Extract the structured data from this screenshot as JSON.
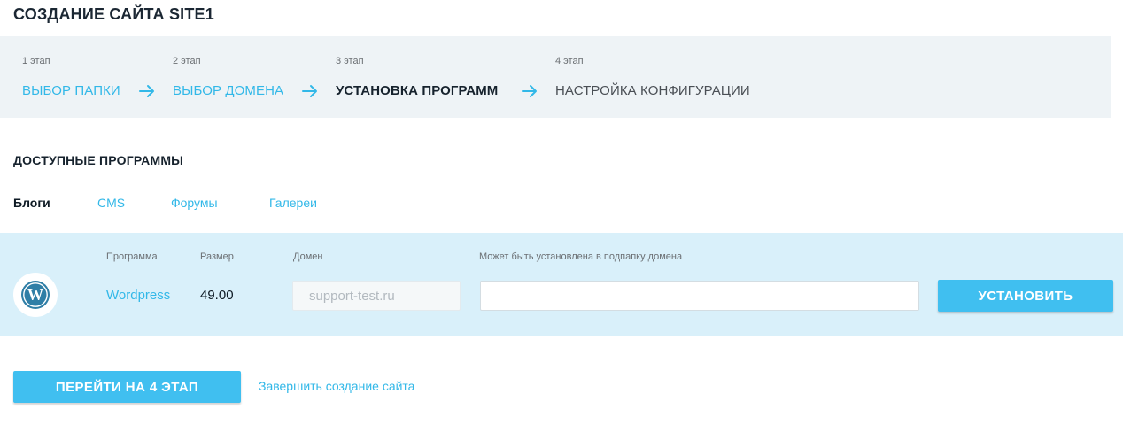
{
  "page": {
    "title": "СОЗДАНИЕ САЙТА SITE1"
  },
  "steps": [
    {
      "number": "1 этап",
      "label": "ВЫБОР ПАПКИ",
      "state": "done"
    },
    {
      "number": "2 этап",
      "label": "ВЫБОР ДОМЕНА",
      "state": "done"
    },
    {
      "number": "3 этап",
      "label": "УСТАНОВКА ПРОГРАММ",
      "state": "current"
    },
    {
      "number": "4 этап",
      "label": "НАСТРОЙКА КОНФИГУРАЦИИ",
      "state": "pending"
    }
  ],
  "available": {
    "title": "ДОСТУПНЫЕ ПРОГРАММЫ",
    "categories": [
      {
        "label": "Блоги",
        "active": true
      },
      {
        "label": "CMS",
        "active": false
      },
      {
        "label": "Форумы",
        "active": false
      },
      {
        "label": "Галереи",
        "active": false
      }
    ]
  },
  "table": {
    "columns": {
      "program": "Программа",
      "size": "Размер",
      "domain": "Домен",
      "subfolder": "Может быть установлена в подпапку домена"
    },
    "rows": [
      {
        "icon": "wordpress-icon",
        "program": "Wordpress",
        "size": "49.00",
        "domain": "support-test.ru",
        "subfolder_value": "",
        "install_label": "УСТАНОВИТЬ"
      }
    ]
  },
  "footer": {
    "next_label": "ПЕРЕЙТИ НА 4 ЭТАП",
    "finish_label": "Завершить создание сайта"
  },
  "colors": {
    "accent": "#40bff0",
    "link": "#32b8e8",
    "steps_bg": "#eef3f6",
    "row_bg": "#d9f0fa"
  }
}
